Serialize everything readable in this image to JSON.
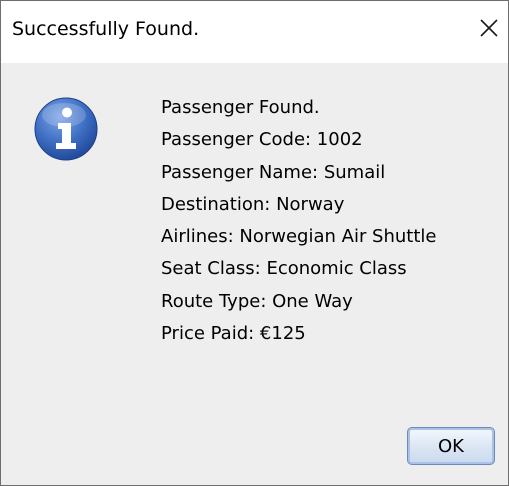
{
  "dialog": {
    "title": "Successfully Found.",
    "close_icon": "close-icon",
    "icon": "information-icon",
    "icon_color": "#2f62b3",
    "messages": [
      "Passenger Found.",
      "Passenger Code: 1002",
      "Passenger Name: Sumail",
      "Destination: Norway",
      "Airlines: Norwegian Air Shuttle",
      "Seat Class: Economic Class",
      "Route Type: One Way",
      "Price Paid: €125"
    ],
    "ok_label": "OK"
  }
}
